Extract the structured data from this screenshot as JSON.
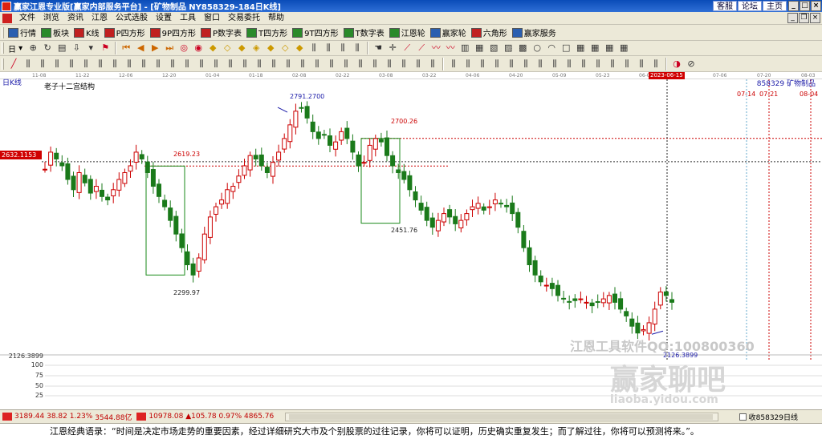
{
  "window": {
    "title": "赢家江恩专业版[赢家内部服务平台] - [矿物制品  NY858329-184日K线]",
    "links": [
      "客服",
      "论坛",
      "主页"
    ]
  },
  "menu": {
    "items": [
      "文件",
      "浏览",
      "资讯",
      "江恩",
      "公式选股",
      "设置",
      "工具",
      "窗口",
      "交易委托",
      "帮助"
    ]
  },
  "toolbar1": {
    "items": [
      {
        "label": "行情",
        "icon": "grid-icon",
        "color": "#2a5fb0"
      },
      {
        "label": "板块",
        "icon": "chart-icon",
        "color": "#2a8a2a"
      },
      {
        "label": "K线",
        "icon": "candle-icon",
        "color": "#c02020"
      },
      {
        "label": "P四方形",
        "icon": "p-square-icon",
        "color": "#c02020"
      },
      {
        "label": "9P四方形",
        "icon": "9p-square-icon",
        "color": "#c02020"
      },
      {
        "label": "P数字表",
        "icon": "p-table-icon",
        "color": "#c02020"
      },
      {
        "label": "T四方形",
        "icon": "t-square-icon",
        "color": "#2a8a2a"
      },
      {
        "label": "9T四方形",
        "icon": "9t-square-icon",
        "color": "#2a8a2a"
      },
      {
        "label": "T数字表",
        "icon": "t-table-icon",
        "color": "#2a8a2a"
      },
      {
        "label": "江恩轮",
        "icon": "wheel-icon",
        "color": "#2a8a2a"
      },
      {
        "label": "赢家轮",
        "icon": "winner-wheel-icon",
        "color": "#2a5fb0"
      },
      {
        "label": "六角形",
        "icon": "hexagon-icon",
        "color": "#c02020"
      },
      {
        "label": "赢家服务",
        "icon": "service-icon",
        "color": "#2a5fb0"
      }
    ]
  },
  "toolbar2": {
    "period_label": "日"
  },
  "time_axis": {
    "labels": [
      "11-08",
      "11-22",
      "12-06",
      "12-20",
      "01-04",
      "01-18",
      "02-08",
      "02-22",
      "03-08",
      "03-22",
      "04-06",
      "04-20",
      "05-09",
      "05-23",
      "06-06"
    ],
    "current_date": "2023-06-15",
    "future_labels": [
      "07-06",
      "07-20",
      "08-03"
    ]
  },
  "chart_panel": {
    "period": "日K线",
    "subtitle": "老子十二宫结构",
    "code_label": "858329 矿物制品",
    "current_price_tag": "2632.1153",
    "rsi_levels": [
      "100",
      "75",
      "50",
      "25"
    ],
    "low_label": "2126.3899",
    "watermark_main": "江恩工具软件QQ:100800360",
    "watermark_logo": "赢家聊吧",
    "watermark_url": "liaoba.yidou.com"
  },
  "chart_data": {
    "type": "candlestick",
    "annotations": [
      {
        "text": "2791.2700",
        "value": 2791.27,
        "kind": "high"
      },
      {
        "text": "2700.26",
        "value": 2700.26,
        "kind": "level"
      },
      {
        "text": "2619.23",
        "value": 2619.23,
        "kind": "level"
      },
      {
        "text": "2451.76",
        "value": 2451.76,
        "kind": "low"
      },
      {
        "text": "2299.97",
        "value": 2299.97,
        "kind": "low"
      },
      {
        "text": "2126.3899",
        "value": 2126.3899,
        "kind": "low"
      }
    ],
    "future_dates": [
      "07-14",
      "07-21",
      "08-04"
    ],
    "closes": [
      2610,
      2660,
      2640,
      2620,
      2580,
      2550,
      2600,
      2570,
      2540,
      2560,
      2530,
      2520,
      2550,
      2580,
      2600,
      2620,
      2660,
      2640,
      2600,
      2560,
      2530,
      2500,
      2460,
      2420,
      2380,
      2330,
      2300,
      2350,
      2420,
      2470,
      2500,
      2520,
      2550,
      2560,
      2590,
      2620,
      2650,
      2640,
      2620,
      2600,
      2630,
      2660,
      2700,
      2740,
      2780,
      2790,
      2760,
      2720,
      2700,
      2710,
      2680,
      2690,
      2720,
      2700,
      2660,
      2620,
      2630,
      2680,
      2700,
      2690,
      2650,
      2620,
      2600,
      2580,
      2550,
      2520,
      2490,
      2460,
      2440,
      2460,
      2480,
      2470,
      2450,
      2460,
      2480,
      2500,
      2510,
      2490,
      2500,
      2520,
      2510,
      2500,
      2480,
      2440,
      2380,
      2330,
      2300,
      2280,
      2270,
      2260,
      2240,
      2230,
      2220,
      2225,
      2230,
      2220,
      2210,
      2220,
      2230,
      2240,
      2220,
      2200,
      2180,
      2150,
      2130,
      2140,
      2160,
      2200,
      2250,
      2240,
      2220
    ],
    "y_range": [
      2080,
      2850
    ]
  },
  "statusbar": {
    "sh_index": "3189.44",
    "sh_change": "38.82",
    "sh_pct": "1.23%",
    "sh_amount": "3544.88亿",
    "sz_index": "10978.08",
    "sz_change": "▲105.78",
    "sz_pct": "0.97%",
    "sz_amount": "4865.76",
    "right_text": "收858329日线"
  },
  "quote": "江恩经典语录：“时间是决定市场走势的重要因素，经过详细研究大市及个别股票的过往记录，你将可以证明，历史确实重复发生；而了解过往，你将可以预测将来。”。",
  "colors": {
    "up": "#cc0000",
    "down": "#1a7a1a",
    "box": "#1a8a1a",
    "accent_blue": "#1a1aa8"
  }
}
